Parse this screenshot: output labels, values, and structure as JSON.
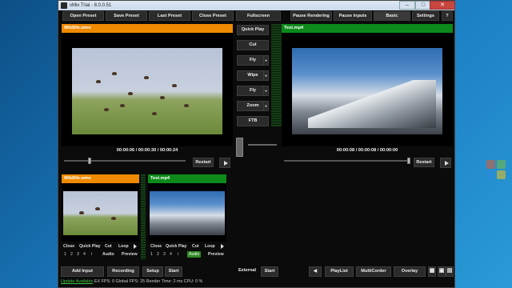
{
  "window": {
    "title": "vMix Trial - 8.0.0.51",
    "min": "–",
    "max": "□",
    "close": "✕"
  },
  "toolbar": {
    "open_preset": "Open Preset",
    "save_preset": "Save Preset",
    "last_preset": "Last Preset",
    "close_preset": "Close Preset",
    "fullscreen": "Fullscreen",
    "pause_rendering": "Pause Rendering",
    "pause_inputs": "Pause Inputs",
    "basic": "Basic",
    "settings": "Settings",
    "help": "?"
  },
  "preview": {
    "title": "Wildlife.wmv",
    "timecode": "00:00:06 / 00:00:30 / 00:00:24",
    "restart": "Restart",
    "progress": 0.2
  },
  "output": {
    "title": "Test.mp4",
    "timecode": "00:00:08 / 00:00:08 / 00:00:00",
    "restart": "Restart",
    "progress": 1.0
  },
  "transitions": [
    {
      "label": "Quick Play",
      "dropdown": false
    },
    {
      "label": "Cut",
      "dropdown": false
    },
    {
      "label": "Fly",
      "dropdown": true
    },
    {
      "label": "Wipe",
      "dropdown": true
    },
    {
      "label": "Fly",
      "dropdown": true
    },
    {
      "label": "Zoom",
      "dropdown": true
    },
    {
      "label": "FTB",
      "dropdown": false
    }
  ],
  "inputs": [
    {
      "title": "Wildlife.wmv",
      "buttons": [
        "Close",
        "Quick Play",
        "Cut",
        "Loop"
      ],
      "numbers": [
        "1",
        "2",
        "3",
        "4",
        "i"
      ],
      "audio": "Audio",
      "preview": "Preview"
    },
    {
      "title": "Test.mp4",
      "buttons": [
        "Close",
        "Quick Play",
        "Cut",
        "Loop"
      ],
      "numbers": [
        "1",
        "2",
        "3",
        "4",
        "i"
      ],
      "audio": "Audio",
      "preview": "Preview"
    }
  ],
  "bottom": {
    "add_input": "Add Input",
    "recording": "Recording",
    "setup": "Setup",
    "start": "Start",
    "external": "External",
    "start2": "Start",
    "playlist": "PlayList",
    "multicorder": "MultiCorder",
    "overlay": "Overlay"
  },
  "status": {
    "update": "Update Available",
    "ex_fps": "EX FPS: 0",
    "global_fps": "Global FPS: 25",
    "render_time": "Render Time: 2 ms",
    "cpu": "CPU: 0 %"
  },
  "colors": {
    "orange": "#f08a00",
    "green": "#0d8a1a",
    "audio_on": "#2e8a22",
    "update": "#3fc23f"
  }
}
